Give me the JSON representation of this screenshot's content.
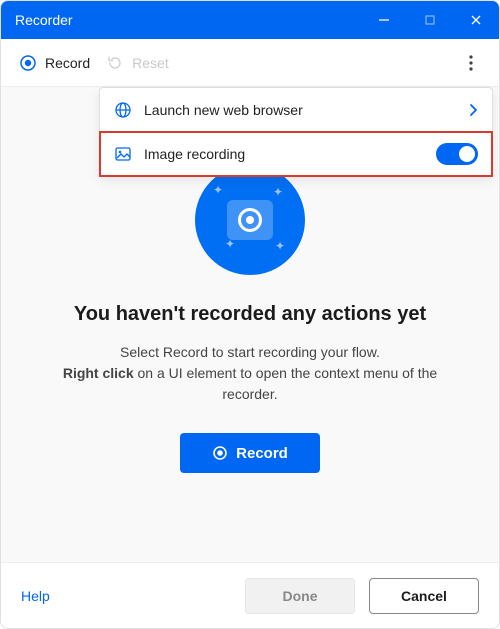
{
  "window": {
    "title": "Recorder"
  },
  "toolbar": {
    "record_label": "Record",
    "reset_label": "Reset"
  },
  "dropdown": {
    "launch_browser_label": "Launch new web browser",
    "image_recording_label": "Image recording",
    "image_recording_on": true
  },
  "empty_state": {
    "headline": "You haven't recorded any actions yet",
    "line1": "Select Record to start recording your flow.",
    "line2a": "Right click",
    "line2b": " on a UI element to open the context menu of the recorder."
  },
  "record_button": {
    "label": "Record"
  },
  "footer": {
    "help_label": "Help",
    "done_label": "Done",
    "cancel_label": "Cancel"
  }
}
